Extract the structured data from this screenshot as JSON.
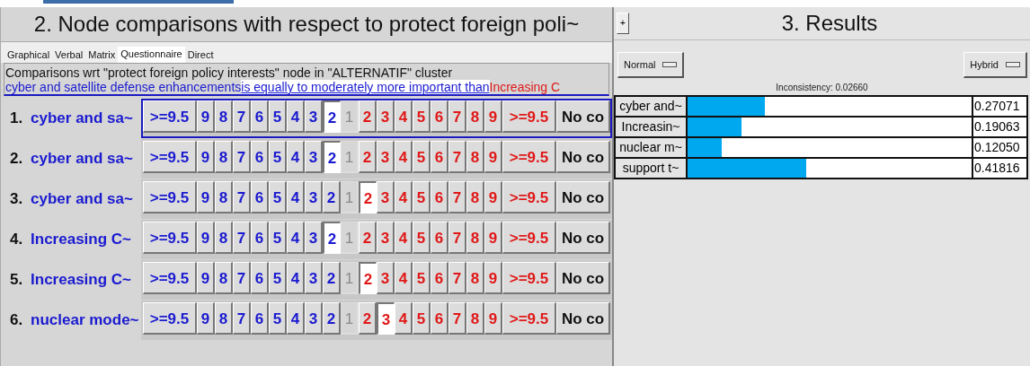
{
  "comparison_panel": {
    "title": "2. Node comparisons with respect to protect foreign poli~",
    "tabs": [
      {
        "label": "Graphical",
        "selected": false
      },
      {
        "label": "Verbal",
        "selected": false
      },
      {
        "label": "Matrix",
        "selected": false
      },
      {
        "label": "Questionnaire",
        "selected": true
      },
      {
        "label": "Direct",
        "selected": false
      }
    ],
    "header": "Comparisons wrt \"protect foreign policy interests\" node in \"ALTERNATIF\" cluster",
    "statement": {
      "left": "cyber and satellite defense enhancements",
      "verb": "is equally to moderately more important than",
      "right": "Increasing C"
    },
    "rows": [
      {
        "number": "1.",
        "label": "cyber and sa~",
        "focused": true,
        "cells": [
          {
            "text": ">=9.5",
            "kind": "left",
            "selected": false
          },
          {
            "text": "9",
            "kind": "left",
            "selected": false
          },
          {
            "text": "8",
            "kind": "left",
            "selected": false
          },
          {
            "text": "7",
            "kind": "left",
            "selected": false
          },
          {
            "text": "6",
            "kind": "left",
            "selected": false
          },
          {
            "text": "5",
            "kind": "left",
            "selected": false
          },
          {
            "text": "4",
            "kind": "left",
            "selected": false
          },
          {
            "text": "3",
            "kind": "left",
            "selected": false
          },
          {
            "text": "2",
            "kind": "left",
            "selected": true
          },
          {
            "text": "1",
            "kind": "equal",
            "selected": false
          },
          {
            "text": "2",
            "kind": "right",
            "selected": false
          },
          {
            "text": "3",
            "kind": "right",
            "selected": false
          },
          {
            "text": "4",
            "kind": "right",
            "selected": false
          },
          {
            "text": "5",
            "kind": "right",
            "selected": false
          },
          {
            "text": "6",
            "kind": "right",
            "selected": false
          },
          {
            "text": "7",
            "kind": "right",
            "selected": false
          },
          {
            "text": "8",
            "kind": "right",
            "selected": false
          },
          {
            "text": "9",
            "kind": "right",
            "selected": false
          },
          {
            "text": ">=9.5",
            "kind": "right",
            "selected": false
          },
          {
            "text": "No co",
            "kind": "none",
            "selected": false
          }
        ]
      },
      {
        "number": "2.",
        "label": "cyber and sa~",
        "focused": false,
        "cells": [
          {
            "text": ">=9.5",
            "kind": "left",
            "selected": false
          },
          {
            "text": "9",
            "kind": "left",
            "selected": false
          },
          {
            "text": "8",
            "kind": "left",
            "selected": false
          },
          {
            "text": "7",
            "kind": "left",
            "selected": false
          },
          {
            "text": "6",
            "kind": "left",
            "selected": false
          },
          {
            "text": "5",
            "kind": "left",
            "selected": false
          },
          {
            "text": "4",
            "kind": "left",
            "selected": false
          },
          {
            "text": "3",
            "kind": "left",
            "selected": false
          },
          {
            "text": "2",
            "kind": "left",
            "selected": true
          },
          {
            "text": "1",
            "kind": "equal",
            "selected": false
          },
          {
            "text": "2",
            "kind": "right",
            "selected": false
          },
          {
            "text": "3",
            "kind": "right",
            "selected": false
          },
          {
            "text": "4",
            "kind": "right",
            "selected": false
          },
          {
            "text": "5",
            "kind": "right",
            "selected": false
          },
          {
            "text": "6",
            "kind": "right",
            "selected": false
          },
          {
            "text": "7",
            "kind": "right",
            "selected": false
          },
          {
            "text": "8",
            "kind": "right",
            "selected": false
          },
          {
            "text": "9",
            "kind": "right",
            "selected": false
          },
          {
            "text": ">=9.5",
            "kind": "right",
            "selected": false
          },
          {
            "text": "No co",
            "kind": "none",
            "selected": false
          }
        ]
      },
      {
        "number": "3.",
        "label": "cyber and sa~",
        "focused": false,
        "cells": [
          {
            "text": ">=9.5",
            "kind": "left",
            "selected": false
          },
          {
            "text": "9",
            "kind": "left",
            "selected": false
          },
          {
            "text": "8",
            "kind": "left",
            "selected": false
          },
          {
            "text": "7",
            "kind": "left",
            "selected": false
          },
          {
            "text": "6",
            "kind": "left",
            "selected": false
          },
          {
            "text": "5",
            "kind": "left",
            "selected": false
          },
          {
            "text": "4",
            "kind": "left",
            "selected": false
          },
          {
            "text": "3",
            "kind": "left",
            "selected": false
          },
          {
            "text": "2",
            "kind": "left",
            "selected": false
          },
          {
            "text": "1",
            "kind": "equal",
            "selected": false
          },
          {
            "text": "2",
            "kind": "right",
            "selected": true
          },
          {
            "text": "3",
            "kind": "right",
            "selected": false
          },
          {
            "text": "4",
            "kind": "right",
            "selected": false
          },
          {
            "text": "5",
            "kind": "right",
            "selected": false
          },
          {
            "text": "6",
            "kind": "right",
            "selected": false
          },
          {
            "text": "7",
            "kind": "right",
            "selected": false
          },
          {
            "text": "8",
            "kind": "right",
            "selected": false
          },
          {
            "text": "9",
            "kind": "right",
            "selected": false
          },
          {
            "text": ">=9.5",
            "kind": "right",
            "selected": false
          },
          {
            "text": "No co",
            "kind": "none",
            "selected": false
          }
        ]
      },
      {
        "number": "4.",
        "label": "Increasing C~",
        "focused": false,
        "cells": [
          {
            "text": ">=9.5",
            "kind": "left",
            "selected": false
          },
          {
            "text": "9",
            "kind": "left",
            "selected": false
          },
          {
            "text": "8",
            "kind": "left",
            "selected": false
          },
          {
            "text": "7",
            "kind": "left",
            "selected": false
          },
          {
            "text": "6",
            "kind": "left",
            "selected": false
          },
          {
            "text": "5",
            "kind": "left",
            "selected": false
          },
          {
            "text": "4",
            "kind": "left",
            "selected": false
          },
          {
            "text": "3",
            "kind": "left",
            "selected": false
          },
          {
            "text": "2",
            "kind": "left",
            "selected": true
          },
          {
            "text": "1",
            "kind": "equal",
            "selected": false
          },
          {
            "text": "2",
            "kind": "right",
            "selected": false
          },
          {
            "text": "3",
            "kind": "right",
            "selected": false
          },
          {
            "text": "4",
            "kind": "right",
            "selected": false
          },
          {
            "text": "5",
            "kind": "right",
            "selected": false
          },
          {
            "text": "6",
            "kind": "right",
            "selected": false
          },
          {
            "text": "7",
            "kind": "right",
            "selected": false
          },
          {
            "text": "8",
            "kind": "right",
            "selected": false
          },
          {
            "text": "9",
            "kind": "right",
            "selected": false
          },
          {
            "text": ">=9.5",
            "kind": "right",
            "selected": false
          },
          {
            "text": "No co",
            "kind": "none",
            "selected": false
          }
        ]
      },
      {
        "number": "5.",
        "label": "Increasing C~",
        "focused": false,
        "cells": [
          {
            "text": ">=9.5",
            "kind": "left",
            "selected": false
          },
          {
            "text": "9",
            "kind": "left",
            "selected": false
          },
          {
            "text": "8",
            "kind": "left",
            "selected": false
          },
          {
            "text": "7",
            "kind": "left",
            "selected": false
          },
          {
            "text": "6",
            "kind": "left",
            "selected": false
          },
          {
            "text": "5",
            "kind": "left",
            "selected": false
          },
          {
            "text": "4",
            "kind": "left",
            "selected": false
          },
          {
            "text": "3",
            "kind": "left",
            "selected": false
          },
          {
            "text": "2",
            "kind": "left",
            "selected": false
          },
          {
            "text": "1",
            "kind": "equal",
            "selected": false
          },
          {
            "text": "2",
            "kind": "right",
            "selected": true
          },
          {
            "text": "3",
            "kind": "right",
            "selected": false
          },
          {
            "text": "4",
            "kind": "right",
            "selected": false
          },
          {
            "text": "5",
            "kind": "right",
            "selected": false
          },
          {
            "text": "6",
            "kind": "right",
            "selected": false
          },
          {
            "text": "7",
            "kind": "right",
            "selected": false
          },
          {
            "text": "8",
            "kind": "right",
            "selected": false
          },
          {
            "text": "9",
            "kind": "right",
            "selected": false
          },
          {
            "text": ">=9.5",
            "kind": "right",
            "selected": false
          },
          {
            "text": "No co",
            "kind": "none",
            "selected": false
          }
        ]
      },
      {
        "number": "6.",
        "label": "nuclear mode~",
        "focused": false,
        "cells": [
          {
            "text": ">=9.5",
            "kind": "left",
            "selected": false
          },
          {
            "text": "9",
            "kind": "left",
            "selected": false
          },
          {
            "text": "8",
            "kind": "left",
            "selected": false
          },
          {
            "text": "7",
            "kind": "left",
            "selected": false
          },
          {
            "text": "6",
            "kind": "left",
            "selected": false
          },
          {
            "text": "5",
            "kind": "left",
            "selected": false
          },
          {
            "text": "4",
            "kind": "left",
            "selected": false
          },
          {
            "text": "3",
            "kind": "left",
            "selected": false
          },
          {
            "text": "2",
            "kind": "left",
            "selected": false
          },
          {
            "text": "1",
            "kind": "equal",
            "selected": false
          },
          {
            "text": "2",
            "kind": "right",
            "selected": false
          },
          {
            "text": "3",
            "kind": "right",
            "selected": true
          },
          {
            "text": "4",
            "kind": "right",
            "selected": false
          },
          {
            "text": "5",
            "kind": "right",
            "selected": false
          },
          {
            "text": "6",
            "kind": "right",
            "selected": false
          },
          {
            "text": "7",
            "kind": "right",
            "selected": false
          },
          {
            "text": "8",
            "kind": "right",
            "selected": false
          },
          {
            "text": "9",
            "kind": "right",
            "selected": false
          },
          {
            "text": ">=9.5",
            "kind": "right",
            "selected": false
          },
          {
            "text": "No co",
            "kind": "none",
            "selected": false
          }
        ]
      }
    ]
  },
  "results_panel": {
    "expand_button": "+",
    "title": "3. Results",
    "mode_dropdown": "Normal",
    "type_dropdown": "Hybrid",
    "inconsistency": "Inconsistency: 0.02660",
    "results": [
      {
        "name": "cyber and~",
        "level": 0.27071,
        "value": "0.27071"
      },
      {
        "name": "Increasin~",
        "level": 0.19063,
        "value": "0.19063"
      },
      {
        "name": "nuclear m~",
        "level": 0.1205,
        "value": "0.12050"
      },
      {
        "name": "support t~",
        "level": 0.41816,
        "value": "0.41816"
      }
    ]
  }
}
